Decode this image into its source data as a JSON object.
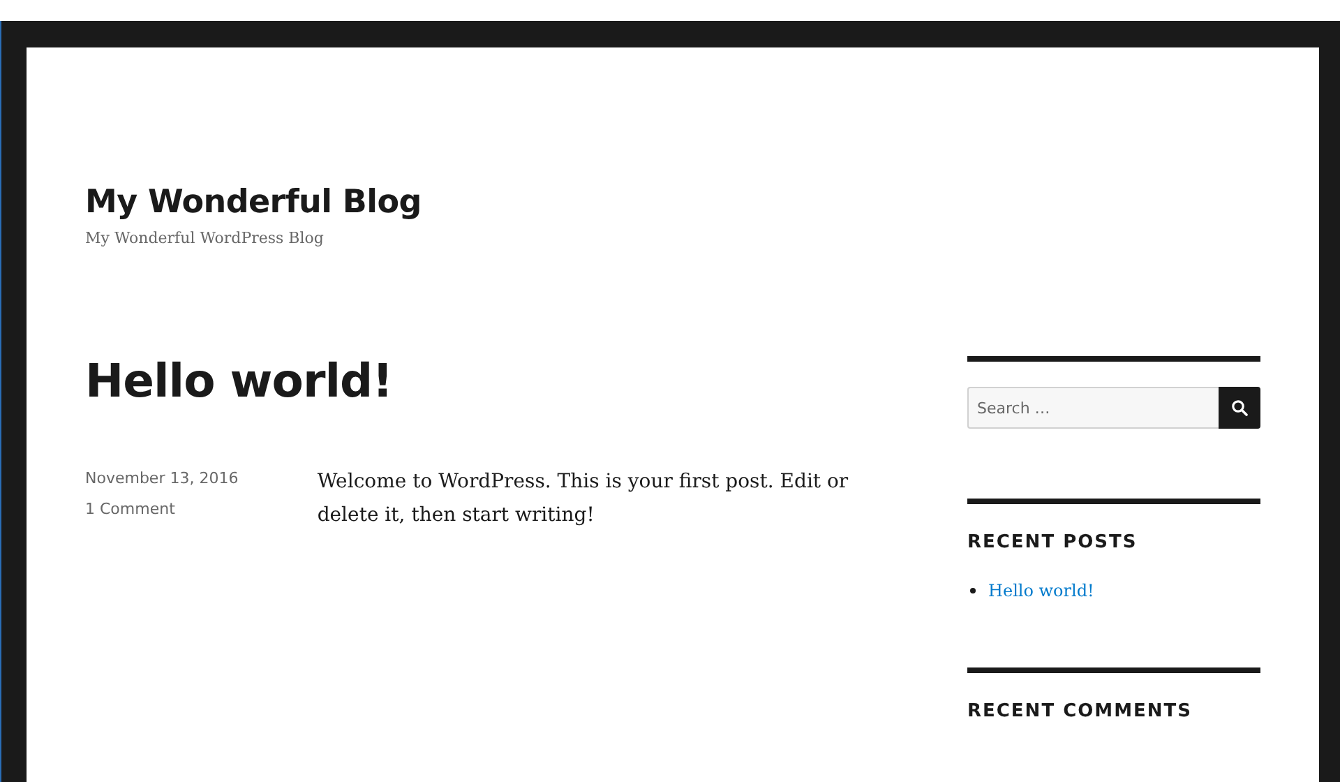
{
  "site": {
    "title": "My Wonderful Blog",
    "tagline": "My Wonderful WordPress Blog"
  },
  "post": {
    "title": "Hello world!",
    "date": "November 13, 2016",
    "comments": "1 Comment",
    "body": "Welcome to WordPress. This is your first post. Edit or delete it, then start writing!"
  },
  "sidebar": {
    "search": {
      "placeholder": "Search …"
    },
    "widgets": [
      {
        "heading": "RECENT POSTS",
        "items": [
          "Hello world!"
        ]
      },
      {
        "heading": "RECENT COMMENTS"
      }
    ]
  }
}
